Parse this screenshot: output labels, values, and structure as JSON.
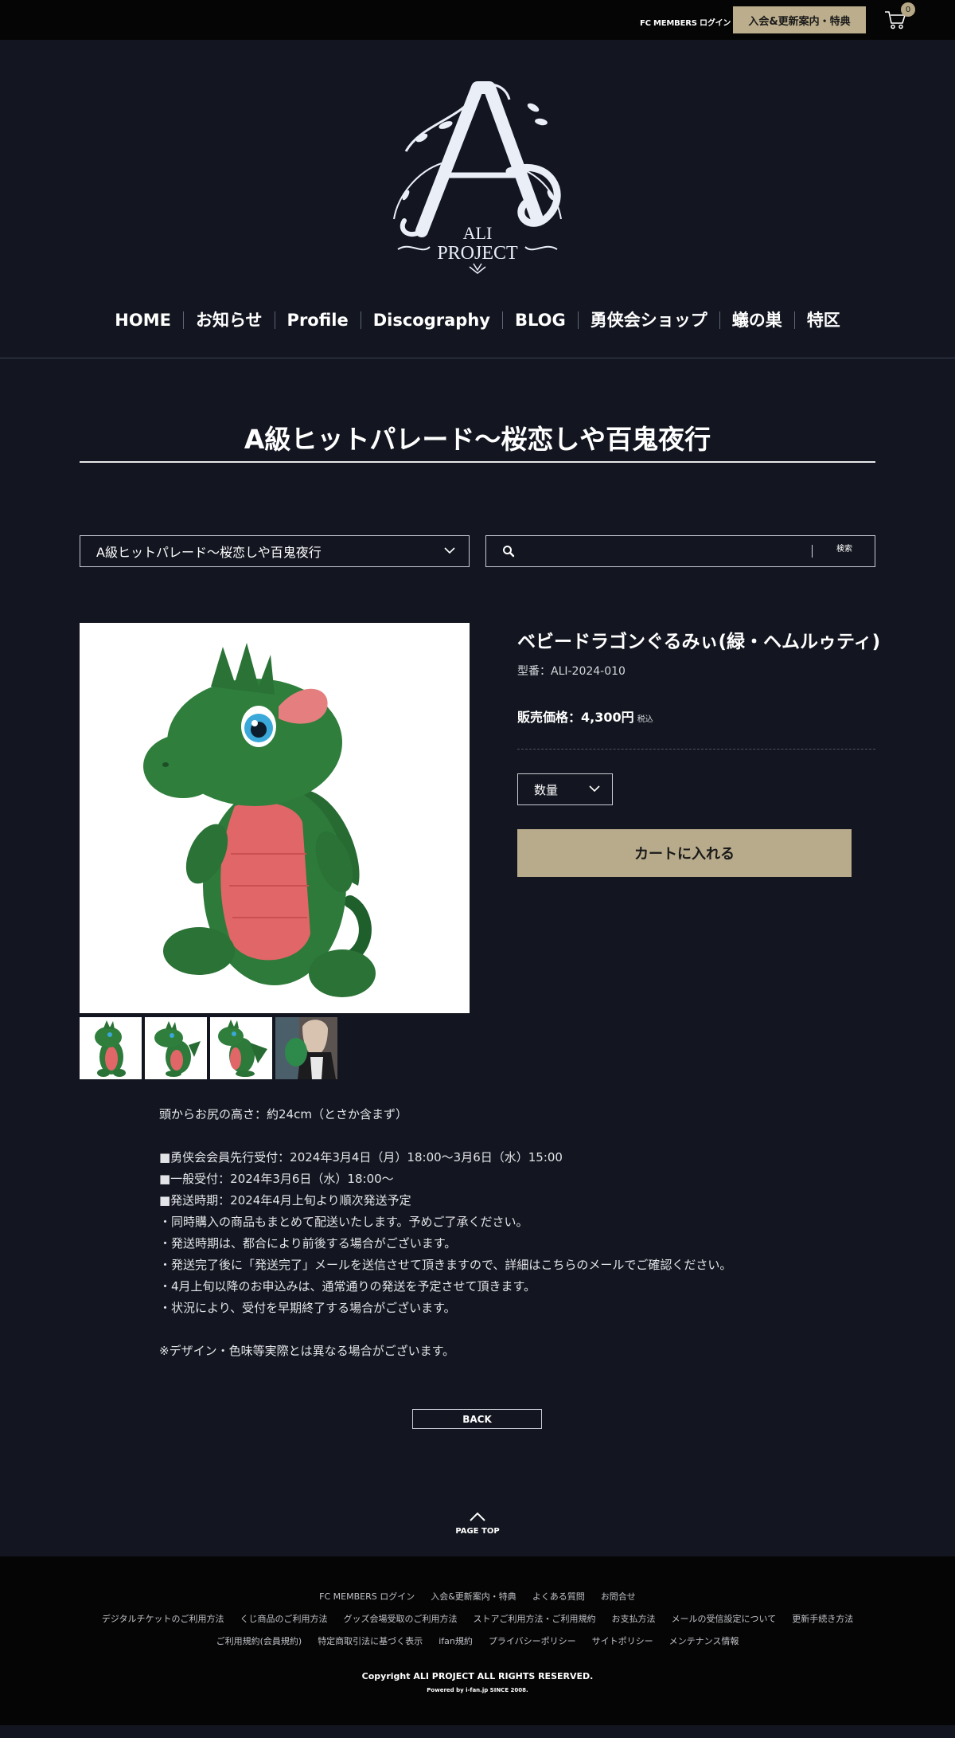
{
  "header": {
    "login_label": "FC MEMBERS ログイン",
    "join_label": "入会&更新案内・特典",
    "cart_count": "0"
  },
  "logo": {
    "line1": "ALI",
    "line2": "PROJECT"
  },
  "nav": {
    "items": [
      "HOME",
      "お知らせ",
      "Profile",
      "Discography",
      "BLOG",
      "勇侠会ショップ",
      "蟻の巣",
      "特区"
    ]
  },
  "page": {
    "title": "A級ヒットパレード〜桜恋しや百鬼夜行"
  },
  "filters": {
    "category_selected": "A級ヒットパレード〜桜恋しや百鬼夜行",
    "search_placeholder": "",
    "search_button": "検索"
  },
  "product": {
    "name": "ベビードラゴンぐるみぃ(緑・ヘムルゥティ)",
    "model": "型番：ALI-2024-010",
    "price_label": "販売価格：4,300円",
    "tax_label": "税込",
    "qty_label": "数量",
    "add_to_cart": "カートに入れる",
    "colors": {
      "body": "#2f7a3c",
      "belly": "#e26a6a",
      "accent": "#b8ab8b"
    }
  },
  "description": {
    "lines": [
      "頭からお尻の高さ：約24cm（とさか含まず）",
      "",
      "■勇侠会会員先行受付：2024年3月4日（月）18:00〜3月6日（水）15:00",
      "■一般受付：2024年3月6日（水）18:00〜",
      "■発送時期：2024年4月上旬より順次発送予定",
      "・同時購入の商品もまとめて配送いたします。予めご了承ください。",
      "・発送時期は、都合により前後する場合がございます。",
      "・発送完了後に「発送完了」メールを送信させて頂きますので、詳細はこちらのメールでご確認ください。",
      "・4月上旬以降のお申込みは、通常通りの発送を予定させて頂きます。",
      "・状況により、受付を早期終了する場合がございます。",
      "",
      "※デザイン・色味等実際とは異なる場合がございます。"
    ]
  },
  "back_label": "BACK",
  "pagetop_label": "PAGE TOP",
  "footer": {
    "row1": [
      "FC MEMBERS ログイン",
      "入会&更新案内・特典",
      "よくある質問",
      "お問合せ"
    ],
    "row2": [
      "デジタルチケットのご利用方法",
      "くじ商品のご利用方法",
      "グッズ会場受取のご利用方法",
      "ストアご利用方法・ご利用規約",
      "お支払方法",
      "メールの受信設定について",
      "更新手続き方法"
    ],
    "row3": [
      "ご利用規約(会員規約)",
      "特定商取引法に基づく表示",
      "ifan規約",
      "プライバシーポリシー",
      "サイトポリシー",
      "メンテナンス情報"
    ],
    "copyright": "Copyright ALI PROJECT ALL RIGHTS RESERVED.",
    "powered": "Powered by i-fan.jp SINCE 2008."
  }
}
